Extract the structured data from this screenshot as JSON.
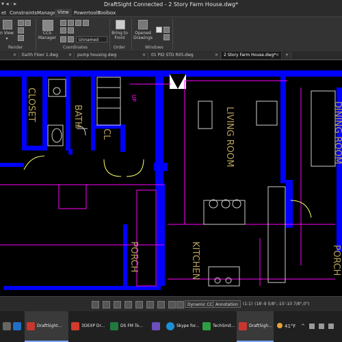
{
  "window": {
    "title": "DraftSight Connected - 2 Story Farm House.dwg*",
    "quick_access": "▾ ◂ · ▸"
  },
  "menu": [
    "et",
    "Constraints",
    "Manage",
    "View",
    "Powertools",
    "Toolbox"
  ],
  "ribbon": {
    "named_view": "n View",
    "named_view_sub": "▾",
    "ccs_manager": "CCS\nManager",
    "ucs_select": "Unnamed",
    "bring_to_front": "Bring to\nFront",
    "opened_drawings": "Opened\nDrawings",
    "groups": [
      "Render",
      "Coordinates",
      "Order",
      "Windows"
    ]
  },
  "tabs": [
    {
      "label": "Earth Floor 1.dwg",
      "close": "✕",
      "active": false
    },
    {
      "label": "pump housing.dwg",
      "close": "✕",
      "active": false
    },
    {
      "label": "01 PID STD R05.dwg",
      "close": "✕",
      "active": false
    },
    {
      "label": "2 Story Farm House.dwg*",
      "close": "✕",
      "active": true
    },
    {
      "label": "+",
      "close": "",
      "active": false
    }
  ],
  "drawing": {
    "rooms": [
      "CLOSET",
      "BATH",
      "CL",
      "LIVING ROOM",
      "DINING ROOM",
      "KITCHEN",
      "PORCH",
      "PORCH"
    ],
    "up_label": "UP",
    "colors": {
      "walls": "#0000ff",
      "annot": "#ff00ff",
      "labels": "#b8a25a",
      "lines": "#d0d0d0",
      "yellow": "#ffff66"
    }
  },
  "statusbar": {
    "dynamic_ccs": "Dynamic CCS",
    "annotation": "Annotation",
    "scale": "(1:1)",
    "coords": "(18'-9 5/8\",-15'-10 7/8\",0\")"
  },
  "taskbar": {
    "items": [
      {
        "label": "DraftSight...",
        "color": "#c8372d"
      },
      {
        "label": "3DEXP Dr...",
        "color": "#d23a2a"
      },
      {
        "label": "DS FM To...",
        "color": "#1e7a3e"
      },
      {
        "label": "Skype for...",
        "color": "#1d8fd6"
      },
      {
        "label": "TechSmit...",
        "color": "#2f9e44"
      },
      {
        "label": "DraftSigh...",
        "color": "#c8372d"
      }
    ],
    "weather": "41°F"
  }
}
